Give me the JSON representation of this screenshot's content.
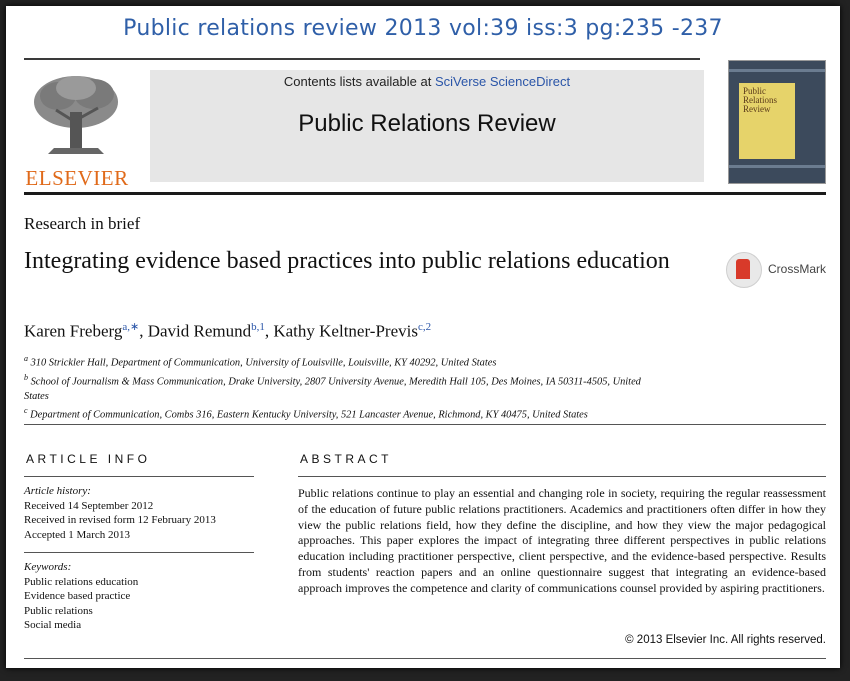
{
  "citation": "Public relations review 2013 vol:39 iss:3 pg:235 -237",
  "publisher": {
    "logo_text": "ELSEVIER"
  },
  "banner": {
    "contents_prefix": "Contents lists available at ",
    "contents_link": "SciVerse ScienceDirect",
    "journal_title": "Public Relations Review"
  },
  "cover": {
    "title": "Public Relations Review"
  },
  "article": {
    "section_type": "Research in brief",
    "title": "Integrating evidence based practices into public relations education",
    "crossmark": "CrossMark",
    "authors": [
      {
        "name": "Karen Freberg",
        "sup": "a,∗"
      },
      {
        "name": "David Remund",
        "sup": "b,1"
      },
      {
        "name": "Kathy Keltner-Previs",
        "sup": "c,2"
      }
    ],
    "affiliations": [
      {
        "sup": "a",
        "text": "310 Strickler Hall, Department of Communication, University of Louisville, Louisville, KY 40292, United States"
      },
      {
        "sup": "b",
        "text": "School of Journalism & Mass Communication, Drake University, 2807 University Avenue, Meredith Hall 105, Des Moines, IA 50311-4505, United States"
      },
      {
        "sup": "c",
        "text": "Department of Communication, Combs 316, Eastern Kentucky University, 521 Lancaster Avenue, Richmond, KY 40475, United States"
      }
    ]
  },
  "article_info": {
    "header": "ARTICLE INFO",
    "history_label": "Article history:",
    "history": [
      "Received 14 September 2012",
      "Received in revised form 12 February 2013",
      "Accepted 1 March 2013"
    ],
    "keywords_label": "Keywords:",
    "keywords": [
      "Public relations education",
      "Evidence based practice",
      "Public relations",
      "Social media"
    ]
  },
  "abstract": {
    "header": "ABSTRACT",
    "text": "Public relations continue to play an essential and changing role in society, requiring the regular reassessment of the education of future public relations practitioners. Academics and practitioners often differ in how they view the public relations field, how they define the discipline, and how they view the major pedagogical approaches. This paper explores the impact of integrating three different perspectives in public relations education including practitioner perspective, client perspective, and the evidence-based perspective. Results from students' reaction papers and an online questionnaire suggest that integrating an evidence-based approach improves the competence and clarity of communications counsel provided by aspiring practitioners.",
    "copyright": "© 2013 Elsevier Inc. All rights reserved."
  },
  "colors": {
    "citation": "#2f5fa8",
    "elsevier": "#e06a1a",
    "link": "#2a55a8",
    "banner_bg": "#e6e6e6",
    "crossmark": "#d83a2a"
  },
  "icons": {
    "publisher_logo": "tree-icon",
    "crossmark": "crossmark-icon"
  }
}
